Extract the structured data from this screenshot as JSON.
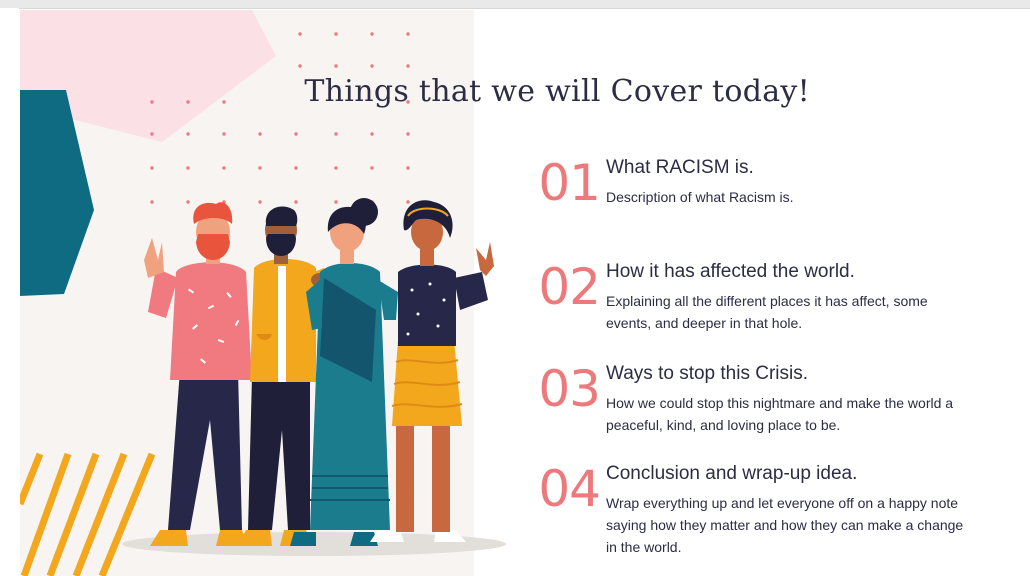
{
  "slide": {
    "title": "Things that we will Cover today!",
    "items": [
      {
        "number": "01",
        "heading": "What RACISM is.",
        "description": "Description of what Racism is."
      },
      {
        "number": "02",
        "heading": "How it has affected the world.",
        "description": "Explaining all the different places it has affect, some events, and deeper in that hole."
      },
      {
        "number": "03",
        "heading": "Ways to stop this Crisis.",
        "description": "How we could stop this nightmare and make the world a peaceful, kind, and loving place to be."
      },
      {
        "number": "04",
        "heading": "Conclusion and wrap-up idea.",
        "description": "Wrap everything up and let everyone off on a happy note saying how they matter and how they can make a change in the world."
      }
    ]
  },
  "colors": {
    "accent": "#ec7a7c",
    "text": "#2c2c44",
    "panel": "#f7f4f2",
    "teal": "#0f6b82",
    "pink": "#fbe0e6",
    "yellow": "#f3a71c"
  },
  "illustration": {
    "description_icon": "people-group-illustration"
  }
}
